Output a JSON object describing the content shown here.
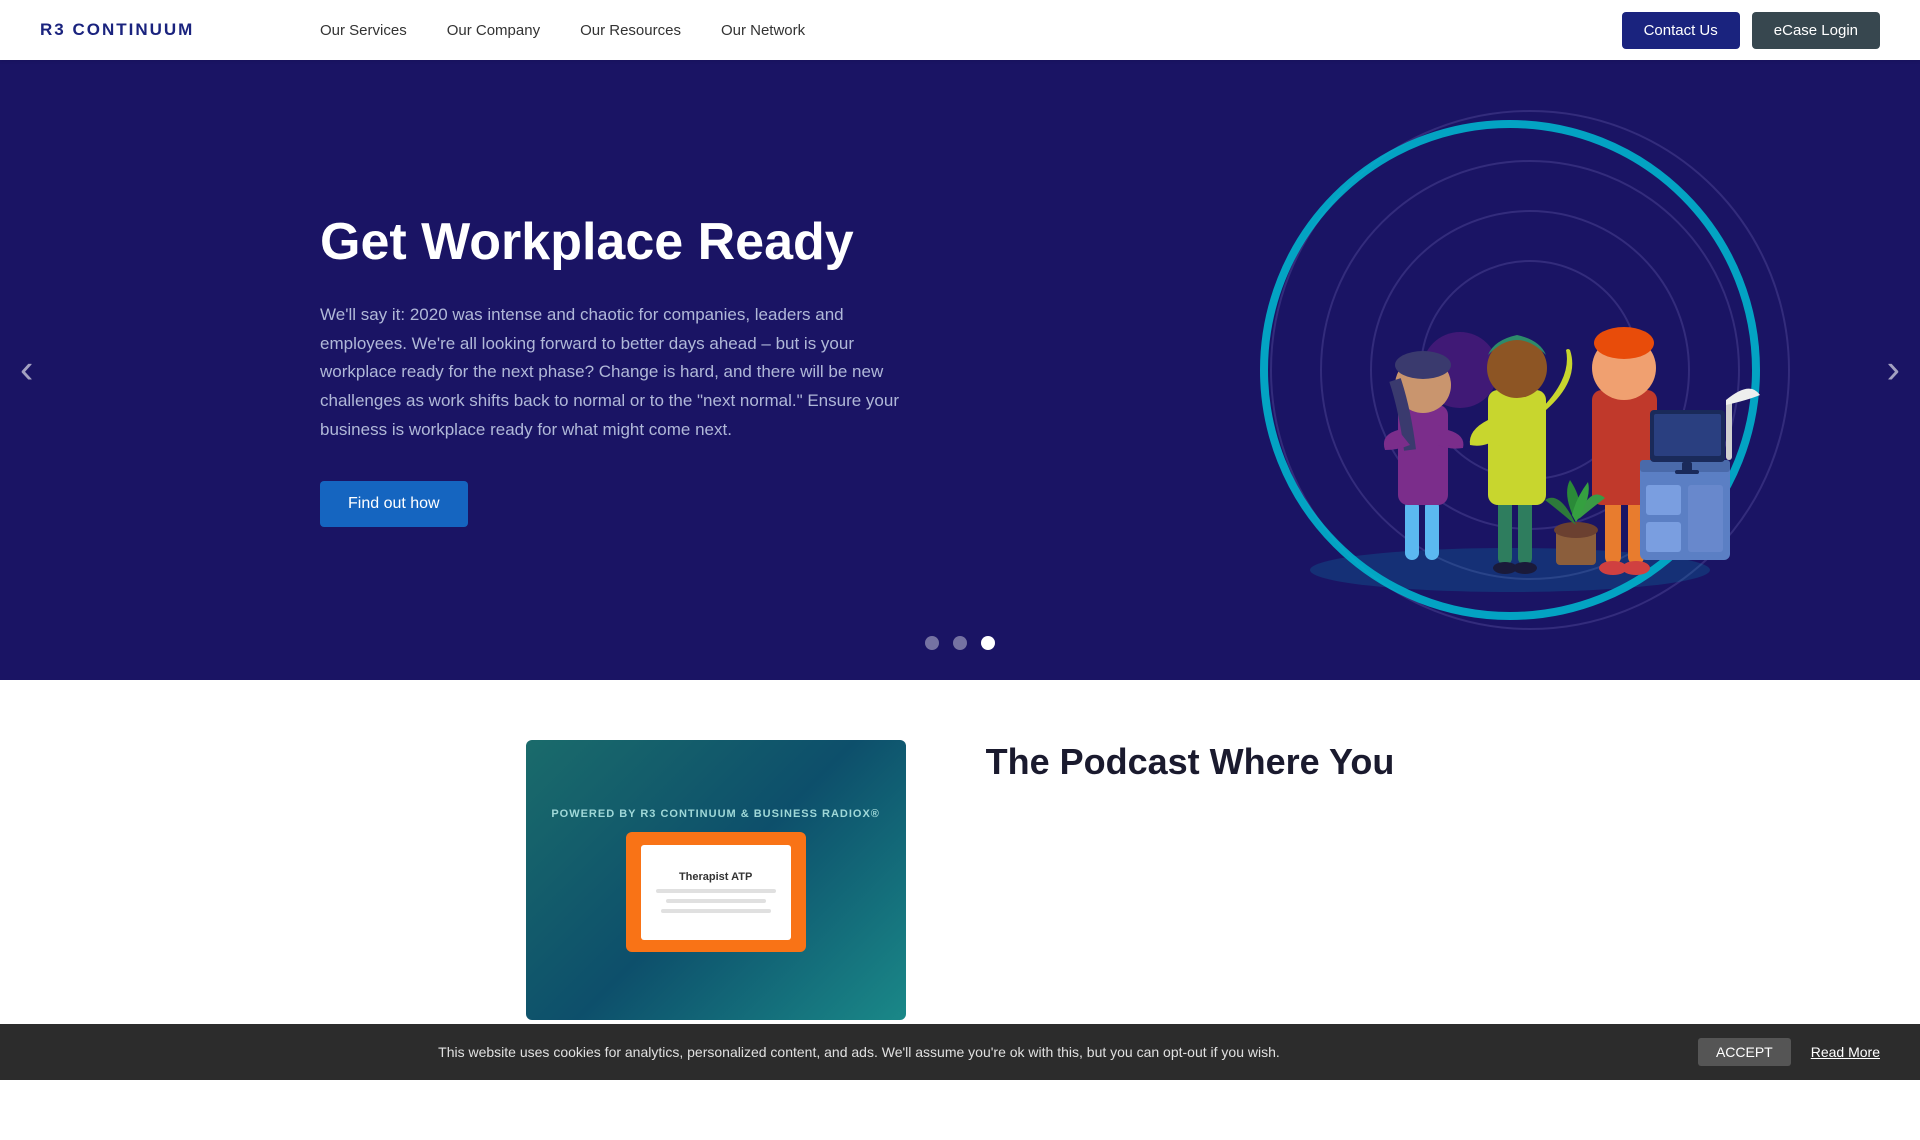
{
  "nav": {
    "logo": "R3 CONTINUUM",
    "links": [
      {
        "label": "Our Services",
        "id": "our-services"
      },
      {
        "label": "Our Company",
        "id": "our-company"
      },
      {
        "label": "Our Resources",
        "id": "our-resources"
      },
      {
        "label": "Our Network",
        "id": "our-network"
      }
    ],
    "contact_label": "Contact Us",
    "ecase_label": "eCase Login"
  },
  "hero": {
    "title": "Get Workplace Ready",
    "description": "We'll say it: 2020 was intense and chaotic for companies, leaders and employees. We're all looking forward to better days ahead – but is your workplace ready for the next phase? Change is hard, and there will be new challenges as work shifts back to normal or to the \"next normal.\" Ensure your business is workplace ready for what might come next.",
    "cta_label": "Find out how",
    "dots": [
      {
        "active": false
      },
      {
        "active": false
      },
      {
        "active": true
      }
    ],
    "prev_label": "‹",
    "next_label": "›"
  },
  "podcast": {
    "image_powered": "POWERED BY R3 CONTINUUM & BUSINESS RADIOX®",
    "image_doc_text": "Therapist ATP",
    "title": "The Podcast Where You"
  },
  "cookie": {
    "message": "This website uses cookies for analytics, personalized content, and ads. We'll assume you're ok with this, but you can opt-out if you wish.",
    "accept_label": "ACCEPT",
    "read_more_label": "Read More"
  }
}
